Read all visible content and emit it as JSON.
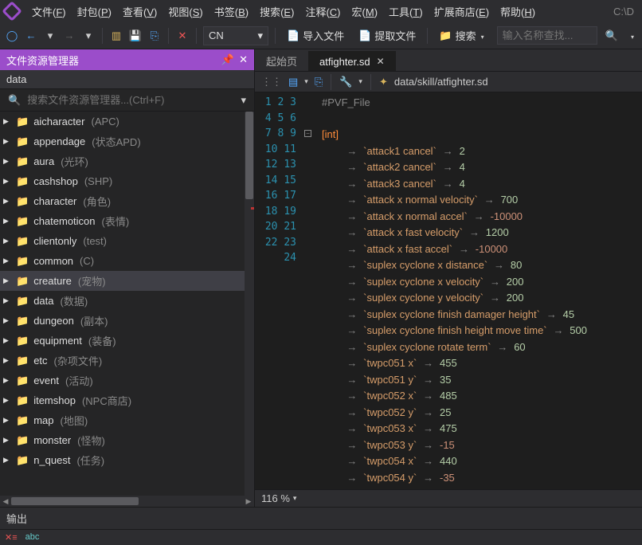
{
  "menu": {
    "items": [
      "文件(F)",
      "封包(P)",
      "查看(V)",
      "视图(S)",
      "书签(B)",
      "搜索(E)",
      "注释(C)",
      "宏(M)",
      "工具(T)",
      "扩展商店(E)",
      "帮助(H)"
    ],
    "pathlabel": "C:\\D"
  },
  "toolbar": {
    "langdd": "CN",
    "import": "导入文件",
    "export": "提取文件",
    "search": "搜索",
    "placeholder": "输入名称查找..."
  },
  "explorer": {
    "title": "文件资源管理器",
    "root": "data",
    "search_placeholder": "搜索文件资源管理器...(Ctrl+F)",
    "items": [
      {
        "name": "aicharacter",
        "note": "(APC)"
      },
      {
        "name": "appendage",
        "note": "(状态APD)"
      },
      {
        "name": "aura",
        "note": "(光环)"
      },
      {
        "name": "cashshop",
        "note": "(SHP)"
      },
      {
        "name": "character",
        "note": "(角色)"
      },
      {
        "name": "chatemoticon",
        "note": "(表情)"
      },
      {
        "name": "clientonly",
        "note": "(test)"
      },
      {
        "name": "common",
        "note": "(C)"
      },
      {
        "name": "creature",
        "note": "(宠物)",
        "selected": true
      },
      {
        "name": "data",
        "note": "(数据)"
      },
      {
        "name": "dungeon",
        "note": "(副本)"
      },
      {
        "name": "equipment",
        "note": "(装备)"
      },
      {
        "name": "etc",
        "note": "(杂项文件)"
      },
      {
        "name": "event",
        "note": "(活动)"
      },
      {
        "name": "itemshop",
        "note": "(NPC商店)"
      },
      {
        "name": "map",
        "note": "(地图)"
      },
      {
        "name": "monster",
        "note": "(怪物)"
      },
      {
        "name": "n_quest",
        "note": "(任务)"
      }
    ]
  },
  "tabs": {
    "start": "起始页",
    "file": "atfighter.sd"
  },
  "breadcrumb": "data/skill/atfighter.sd",
  "code": {
    "header": "#PVF_File",
    "section": "[int]",
    "lines": [
      {
        "key": "attack1 cancel",
        "val": "2"
      },
      {
        "key": "attack2 cancel",
        "val": "4"
      },
      {
        "key": "attack3 cancel",
        "val": "4"
      },
      {
        "key": "attack x normal velocity",
        "val": "700"
      },
      {
        "key": "attack x normal accel",
        "val": "-10000",
        "neg": true
      },
      {
        "key": "attack x fast velocity",
        "val": "1200"
      },
      {
        "key": "attack x fast accel",
        "val": "-10000",
        "neg": true
      },
      {
        "key": "suplex cyclone x distance",
        "val": "80"
      },
      {
        "key": "suplex cyclone x velocity",
        "val": "200"
      },
      {
        "key": "suplex cyclone y velocity",
        "val": "200"
      },
      {
        "key": "suplex cyclone finish damager height",
        "val": "45"
      },
      {
        "key": "suplex cyclone finish height move time",
        "val": "500"
      },
      {
        "key": "suplex cyclone rotate term",
        "val": "60"
      },
      {
        "key": "twpc051 x",
        "val": "455"
      },
      {
        "key": "twpc051 y",
        "val": "35"
      },
      {
        "key": "twpc052 x",
        "val": "485"
      },
      {
        "key": "twpc052 y",
        "val": "25"
      },
      {
        "key": "twpc053 x",
        "val": "475"
      },
      {
        "key": "twpc053 y",
        "val": "-15",
        "neg": true
      },
      {
        "key": "twpc054 x",
        "val": "440"
      },
      {
        "key": "twpc054 y",
        "val": "-35",
        "neg": true
      }
    ],
    "zoom": "116 %"
  },
  "output": {
    "title": "输出"
  }
}
